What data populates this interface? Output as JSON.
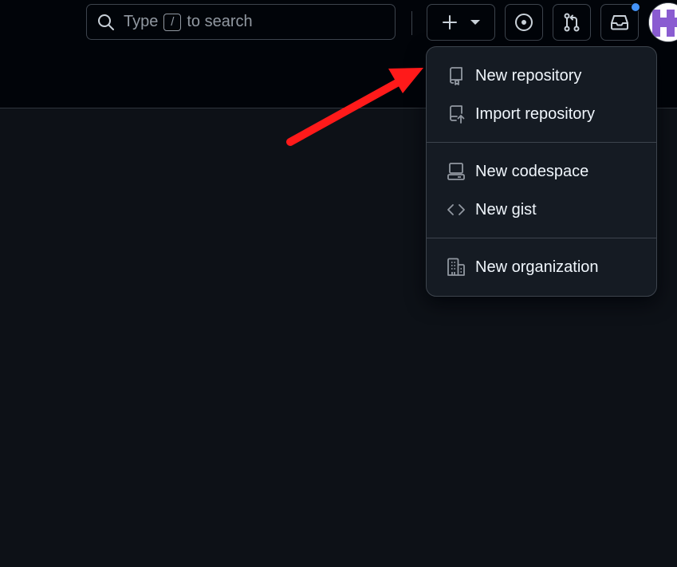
{
  "search": {
    "prefix": "Type",
    "shortcut": "/",
    "suffix": "to search",
    "icon": "search-icon"
  },
  "header": {
    "create_button_icon": "plus-icon",
    "create_dropdown_icon": "triangle-down-icon",
    "issues_icon": "issue-opened-icon",
    "pull_requests_icon": "git-pull-request-icon",
    "inbox_icon": "inbox-icon",
    "notification_color": "#4493f8",
    "avatar_color": "#8a5cd1"
  },
  "menu": {
    "items": [
      {
        "label": "New repository",
        "icon": "repo-icon"
      },
      {
        "label": "Import repository",
        "icon": "repo-push-icon"
      },
      {
        "label": "New codespace",
        "icon": "codespaces-icon"
      },
      {
        "label": "New gist",
        "icon": "code-icon"
      },
      {
        "label": "New organization",
        "icon": "organization-icon"
      }
    ]
  },
  "annotation": {
    "color": "#ff1a1a"
  }
}
